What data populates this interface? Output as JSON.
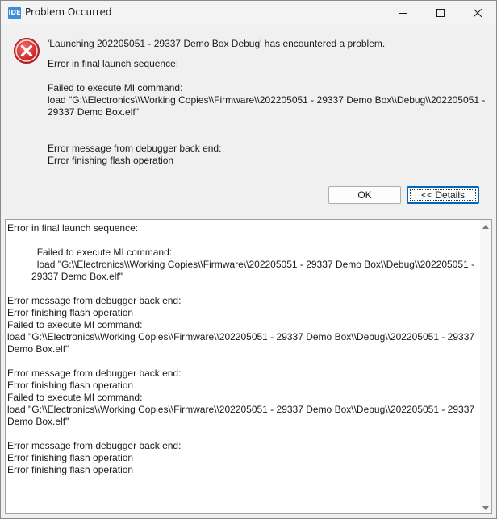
{
  "window": {
    "title": "Problem Occurred",
    "app_icon_label": "IDE",
    "icons": {
      "minimize": "minimize-icon",
      "maximize": "maximize-icon",
      "close": "close-icon"
    }
  },
  "message": {
    "icon": "error-icon",
    "headline": "'Launching 202205051 - 29337 Demo Box Debug' has encountered a problem.",
    "lines": [
      "Error in final launch sequence:",
      "Failed to execute MI command:",
      "load \"G:\\\\Electronics\\\\Working Copies\\\\Firmware\\\\202205051 - 29337 Demo Box\\\\Debug\\\\202205051 -",
      "29337 Demo Box.elf\"",
      "Error message from debugger back end:",
      "Error finishing flash operation"
    ]
  },
  "buttons": {
    "ok": "OK",
    "details": "<< Details"
  },
  "details": {
    "lines": [
      "Error in final launch sequence:",
      "",
      "           Failed to execute MI command:",
      "           load \"G:\\\\Electronics\\\\Working Copies\\\\Firmware\\\\202205051 - 29337 Demo Box\\\\Debug\\\\202205051 -",
      "         29337 Demo Box.elf\"",
      "",
      "Error message from debugger back end:",
      "Error finishing flash operation",
      "Failed to execute MI command:",
      "load \"G:\\\\Electronics\\\\Working Copies\\\\Firmware\\\\202205051 - 29337 Demo Box\\\\Debug\\\\202205051 - 29337",
      "Demo Box.elf\"",
      "",
      "Error message from debugger back end:",
      "Error finishing flash operation",
      "Failed to execute MI command:",
      "load \"G:\\\\Electronics\\\\Working Copies\\\\Firmware\\\\202205051 - 29337 Demo Box\\\\Debug\\\\202205051 - 29337",
      "Demo Box.elf\"",
      "",
      "Error message from debugger back end:",
      "Error finishing flash operation",
      "Error finishing flash operation"
    ]
  },
  "colors": {
    "error_red": "#d32f2f",
    "focus_blue": "#0067c0",
    "window_bg": "#f0f0f0"
  }
}
